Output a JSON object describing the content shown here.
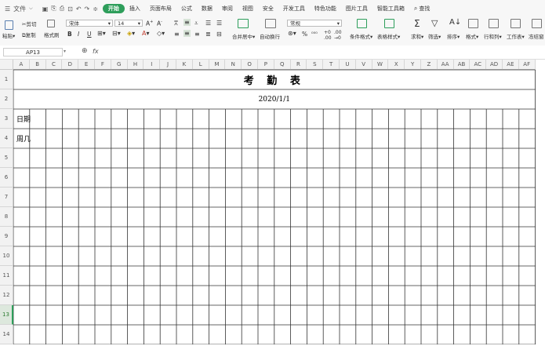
{
  "menubar": {
    "file_label": "文件",
    "tabs": [
      "开始",
      "插入",
      "页面布局",
      "公式",
      "数据",
      "审阅",
      "视图",
      "安全",
      "开发工具",
      "特色功能",
      "图片工具",
      "智能工具箱"
    ],
    "active_tab": "开始",
    "search_label": "查找"
  },
  "ribbon": {
    "cut": "剪切",
    "paste": "粘贴",
    "copy": "复制",
    "format_painter": "格式刷",
    "font_name": "宋体",
    "font_size": "14",
    "bold": "B",
    "italic": "I",
    "underline": "U",
    "merge_center": "合并居中",
    "auto_wrap": "自动换行",
    "number_format": "常规",
    "percent": "%",
    "cond_format": "条件格式",
    "table_style": "表格样式",
    "sum": "求和",
    "filter": "筛选",
    "sort": "排序",
    "format": "格式",
    "row_col": "行和列",
    "worksheet": "工作表",
    "freeze": "冻结窗"
  },
  "formula": {
    "cell_ref": "AP13",
    "fx": "fx"
  },
  "sheet": {
    "columns": [
      "A",
      "B",
      "C",
      "D",
      "E",
      "F",
      "G",
      "H",
      "I",
      "J",
      "K",
      "L",
      "M",
      "N",
      "O",
      "P",
      "Q",
      "R",
      "S",
      "T",
      "U",
      "V",
      "W",
      "X",
      "Y",
      "Z",
      "AA",
      "AB",
      "AC",
      "AD",
      "AE",
      "AF"
    ],
    "rows": [
      "1",
      "2",
      "3",
      "4",
      "5",
      "6",
      "7",
      "8",
      "9",
      "10",
      "11",
      "12",
      "13",
      "14"
    ],
    "selected_row": "13",
    "title": "考 勤 表",
    "date": "2020/1/1",
    "label_date": "日期",
    "label_weekday": "周几"
  },
  "colors": {
    "accent": "#2e9e5b",
    "grid_line": "#333333",
    "header_bg": "#f2f2f2"
  }
}
